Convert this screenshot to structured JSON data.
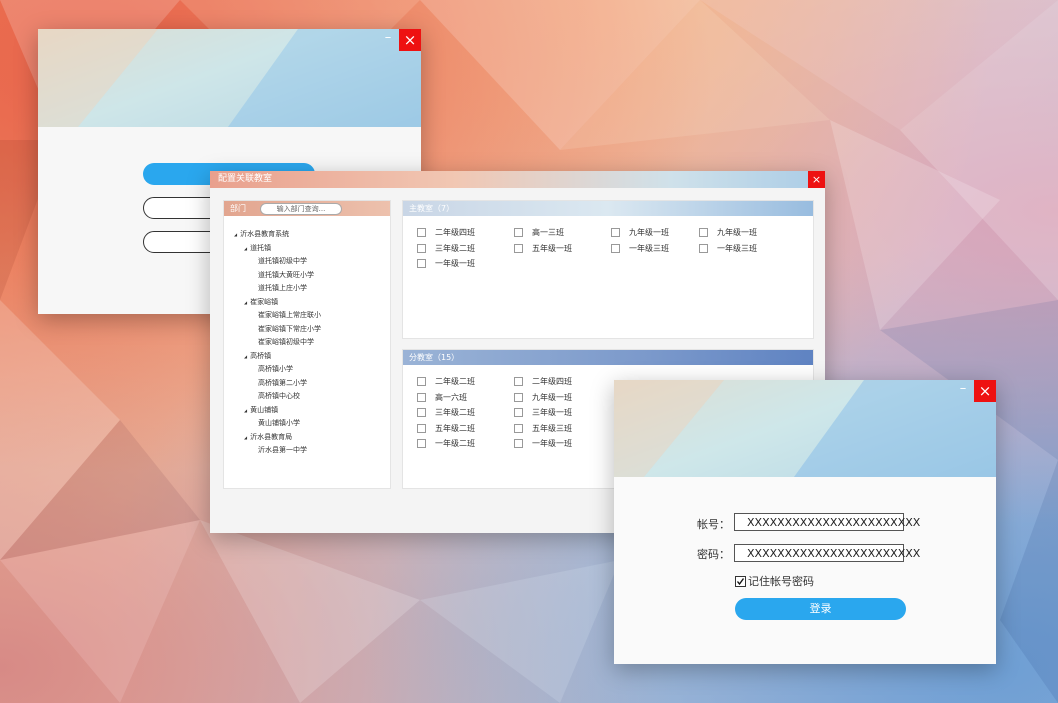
{
  "colors": {
    "close_red": "#e11111",
    "accent_blue": "#2aa7ee",
    "dept_header": "#e2a58f",
    "main_room_header": "#a9c6e0",
    "branch_room_header": "#6e8fc6"
  },
  "icons": {
    "close": "close-icon",
    "minimize": "minimize-icon",
    "checkbox": "checkbox-icon",
    "tree_toggle": "caret-icon"
  },
  "window_back": {
    "close_label": "×",
    "minimize_label": "–"
  },
  "config_window": {
    "title": "配置关联教室",
    "close_label": "×",
    "dept_panel": {
      "header": "部门",
      "search_placeholder": "输入部门查询..."
    },
    "tree": [
      {
        "label": "沂水县教育系统",
        "level": 0,
        "toggle": "◢"
      },
      {
        "label": "道托镇",
        "level": 1,
        "toggle": "◢"
      },
      {
        "label": "道托镇初级中学",
        "level": 2,
        "toggle": ""
      },
      {
        "label": "道托镇大黄旺小学",
        "level": 2,
        "toggle": ""
      },
      {
        "label": "道托镇上庄小学",
        "level": 2,
        "toggle": ""
      },
      {
        "label": "崔家峪镇",
        "level": 1,
        "toggle": "◢"
      },
      {
        "label": "崔家峪镇上常庄联小",
        "level": 2,
        "toggle": ""
      },
      {
        "label": "崔家峪镇下常庄小学",
        "level": 2,
        "toggle": ""
      },
      {
        "label": "崔家峪镇初级中学",
        "level": 2,
        "toggle": ""
      },
      {
        "label": "高桥镇",
        "level": 1,
        "toggle": "◢"
      },
      {
        "label": "高桥镇小学",
        "level": 2,
        "toggle": ""
      },
      {
        "label": "高桥镇第二小学",
        "level": 2,
        "toggle": ""
      },
      {
        "label": "高桥镇中心校",
        "level": 2,
        "toggle": ""
      },
      {
        "label": "黄山铺镇",
        "level": 1,
        "toggle": "◢"
      },
      {
        "label": "黄山铺镇小学",
        "level": 2,
        "toggle": ""
      },
      {
        "label": "沂水县教育局",
        "level": 1,
        "toggle": "◢"
      },
      {
        "label": "沂水县第一中学",
        "level": 2,
        "toggle": ""
      }
    ],
    "main_rooms": {
      "header": "主教室（7）",
      "items": [
        "二年级四班",
        "高一三班",
        "九年级一班",
        "九年级一班",
        "三年级二班",
        "五年级一班",
        "一年级三班",
        "一年级三班",
        "一年级一班"
      ]
    },
    "branch_rooms": {
      "header": "分教室（15）",
      "items": [
        "二年级二班",
        "二年级四班",
        "高一六班",
        "九年级一班",
        "三年级二班",
        "三年级一班",
        "五年级二班",
        "五年级三班",
        "一年级二班",
        "一年级一班"
      ]
    }
  },
  "login_window": {
    "close_label": "×",
    "minimize_label": "–",
    "account_label": "帐号：",
    "account_value": "XXXXXXXXXXXXXXXXXXXXXXX",
    "password_label": "密码：",
    "password_value": "XXXXXXXXXXXXXXXXXXXXXXX",
    "remember_label": "记住帐号密码",
    "remember_checked": true,
    "login_label": "登录"
  }
}
